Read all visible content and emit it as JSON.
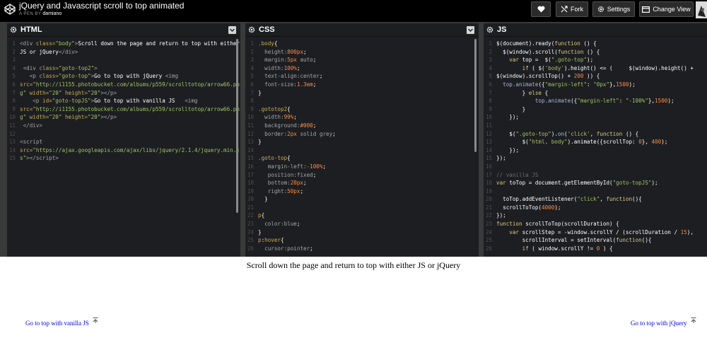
{
  "header": {
    "title": "jQuery and Javascript scroll to top animated",
    "byline_prefix": "A PEN BY ",
    "author": "damiano",
    "buttons": {
      "heart_label": "",
      "fork_label": "Fork",
      "settings_label": "Settings",
      "change_view_label": "Change View"
    }
  },
  "panels": {
    "html": {
      "name": "HTML",
      "lines": [
        [
          [
            "c-tag",
            "<div "
          ],
          [
            "c-at",
            "class="
          ],
          [
            "c-st",
            "\"body\""
          ],
          [
            "c-tag",
            ">"
          ],
          [
            "c-tx",
            "Scroll down the page and return to top with either"
          ]
        ],
        [
          [
            "c-tx",
            "JS or jQuery"
          ],
          [
            "c-tag",
            "</div>"
          ]
        ],
        [],
        [
          [
            "c-tag",
            " <div "
          ],
          [
            "c-at",
            "class="
          ],
          [
            "c-st",
            "\"goto-top2\""
          ],
          [
            "c-tag",
            ">"
          ]
        ],
        [
          [
            "c-tag",
            "   <p "
          ],
          [
            "c-at",
            "class="
          ],
          [
            "c-st",
            "\"goto-top\""
          ],
          [
            "c-tag",
            ">"
          ],
          [
            "c-tx",
            "Go to top with jQuery "
          ],
          [
            "c-tag",
            "<img"
          ]
        ],
        [
          [
            "c-at",
            "src="
          ],
          [
            "c-st",
            "\"http://i1155.photobucket.com/albums/p559/scrolltotop/arrow66.pn"
          ]
        ],
        [
          [
            "c-st",
            "g\" "
          ],
          [
            "c-at",
            "width="
          ],
          [
            "c-st",
            "\"20\" "
          ],
          [
            "c-at",
            "height="
          ],
          [
            "c-st",
            "\"20\""
          ],
          [
            "c-tag",
            "></p>"
          ]
        ],
        [
          [
            "c-tag",
            "    <p "
          ],
          [
            "c-at",
            "id="
          ],
          [
            "c-st",
            "\"goto-topJS\""
          ],
          [
            "c-tag",
            ">"
          ],
          [
            "c-tx",
            "Go to top with vanilla JS   "
          ],
          [
            "c-tag",
            "<img"
          ]
        ],
        [
          [
            "c-at",
            "src="
          ],
          [
            "c-st",
            "\"http://i1155.photobucket.com/albums/p559/scrolltotop/arrow66.pn"
          ]
        ],
        [
          [
            "c-st",
            "g\" "
          ],
          [
            "c-at",
            "width="
          ],
          [
            "c-st",
            "\"20\" "
          ],
          [
            "c-at",
            "height="
          ],
          [
            "c-st",
            "\"20\""
          ],
          [
            "c-tag",
            "></p>"
          ]
        ],
        [
          [
            "c-tag",
            " </div>"
          ]
        ],
        [],
        [
          [
            "c-tag",
            "<script"
          ]
        ],
        [
          [
            "c-at",
            "src="
          ],
          [
            "c-st",
            "\"https://ajax.googleapis.com/ajax/libs/jquery/2.1.4/jquery.min.j"
          ]
        ],
        [
          [
            "c-st",
            "s\""
          ],
          [
            "c-tag",
            "></"
          ],
          [
            "c-tag",
            "script>"
          ]
        ]
      ]
    },
    "css": {
      "name": "CSS",
      "lines": [
        [
          [
            "c-sel",
            ".body"
          ],
          [
            "c-pn",
            "{"
          ]
        ],
        [
          [
            "c-pr",
            "  height:"
          ],
          [
            "c-val",
            "800px"
          ],
          [
            "c-pn",
            ";"
          ]
        ],
        [
          [
            "c-pr",
            "  margin:"
          ],
          [
            "c-val",
            "5px "
          ],
          [
            "c-pr",
            "auto"
          ],
          [
            "c-pn",
            ";"
          ]
        ],
        [
          [
            "c-pr",
            "  width:"
          ],
          [
            "c-val",
            "100%"
          ],
          [
            "c-pn",
            ";"
          ]
        ],
        [
          [
            "c-pr",
            "  text-align:"
          ],
          [
            "c-pr",
            "center"
          ],
          [
            "c-pn",
            ";"
          ]
        ],
        [
          [
            "c-pr",
            "  font-size:"
          ],
          [
            "c-val",
            "1.3em"
          ],
          [
            "c-pn",
            ";"
          ]
        ],
        [
          [
            "c-pn",
            "}"
          ]
        ],
        [],
        [
          [
            "c-sel",
            ".gototop2"
          ],
          [
            "c-pn",
            "{"
          ]
        ],
        [
          [
            "c-pr",
            "  width:"
          ],
          [
            "c-val",
            "99%"
          ],
          [
            "c-pn",
            ";"
          ]
        ],
        [
          [
            "c-pr",
            "  background:"
          ],
          [
            "c-val",
            "#000"
          ],
          [
            "c-pn",
            ";"
          ]
        ],
        [
          [
            "c-pr",
            "  border:"
          ],
          [
            "c-val",
            "2px "
          ],
          [
            "c-pr",
            "solid grey"
          ],
          [
            "c-pn",
            ";"
          ]
        ],
        [
          [
            "c-pn",
            "}"
          ]
        ],
        [],
        [
          [
            "c-sel",
            ".goto-top"
          ],
          [
            "c-pn",
            "{"
          ]
        ],
        [
          [
            "c-pr",
            "   margin-left:"
          ],
          [
            "c-val",
            "-100%"
          ],
          [
            "c-pn",
            ";"
          ]
        ],
        [
          [
            "c-pr",
            "   position:"
          ],
          [
            "c-pr",
            "fixed"
          ],
          [
            "c-pn",
            ";"
          ]
        ],
        [
          [
            "c-pr",
            "   bottom:"
          ],
          [
            "c-val",
            "20px"
          ],
          [
            "c-pn",
            ";"
          ]
        ],
        [
          [
            "c-pr",
            "   right:"
          ],
          [
            "c-val",
            "50px"
          ],
          [
            "c-pn",
            ";"
          ]
        ],
        [
          [
            "c-pn",
            "  }"
          ]
        ],
        [],
        [
          [
            "c-sel",
            "p"
          ],
          [
            "c-pn",
            "{"
          ]
        ],
        [
          [
            "c-pr",
            "  color:"
          ],
          [
            "c-pr",
            "blue"
          ],
          [
            "c-pn",
            ";"
          ]
        ],
        [
          [
            "c-pn",
            "}"
          ]
        ],
        [
          [
            "c-sel",
            "p"
          ],
          [
            "c-pn",
            ":"
          ],
          [
            "c-sel",
            "hover"
          ],
          [
            "c-pn",
            "{"
          ]
        ],
        [
          [
            "c-pr",
            "  cursor:"
          ],
          [
            "c-pr",
            "pointer"
          ],
          [
            "c-pn",
            ";"
          ]
        ]
      ]
    },
    "js": {
      "name": "JS",
      "lines": [
        [
          [
            "c-fn",
            "$(document).ready("
          ],
          [
            "c-kw",
            "function"
          ],
          [
            "c-fn",
            " () {"
          ]
        ],
        [
          [
            "c-fn",
            "  $(window).scroll("
          ],
          [
            "c-kw",
            "function"
          ],
          [
            "c-fn",
            " () {"
          ]
        ],
        [
          [
            "c-kw",
            "    var "
          ],
          [
            "c-id",
            "top = "
          ],
          [
            "c-fn",
            " $("
          ],
          [
            "c-jsstr",
            "\".goto-top\""
          ],
          [
            "c-fn",
            ");"
          ]
        ],
        [
          [
            "c-kw",
            "        if "
          ],
          [
            "c-fn",
            "( $("
          ],
          [
            "c-jsstr",
            "'body'"
          ],
          [
            "c-fn",
            ").height() <= (     $(window).height() +"
          ]
        ],
        [
          [
            "c-fn",
            "$(window).scrollTop() + "
          ],
          [
            "c-num",
            "200"
          ],
          [
            "c-fn",
            " )) {"
          ]
        ],
        [
          [
            "c-prop",
            "  top.animate"
          ],
          [
            "c-fn",
            "({"
          ],
          [
            "c-jsstr",
            "\"margin-left\""
          ],
          [
            "c-fn",
            ": "
          ],
          [
            "c-jsstr",
            "\"0px\""
          ],
          [
            "c-fn",
            "},"
          ],
          [
            "c-num",
            "1500"
          ],
          [
            "c-fn",
            ");"
          ]
        ],
        [
          [
            "c-fn",
            "        } "
          ],
          [
            "c-kw",
            "else"
          ],
          [
            "c-fn",
            " {"
          ]
        ],
        [
          [
            "c-prop",
            "            top.animate"
          ],
          [
            "c-fn",
            "({"
          ],
          [
            "c-jsstr",
            "\"margin-left\""
          ],
          [
            "c-fn",
            ": "
          ],
          [
            "c-jsstr",
            "\"-100%\""
          ],
          [
            "c-fn",
            "},"
          ],
          [
            "c-num",
            "1500"
          ],
          [
            "c-fn",
            ");"
          ]
        ],
        [
          [
            "c-fn",
            "        }"
          ]
        ],
        [
          [
            "c-fn",
            "    });"
          ]
        ],
        [],
        [
          [
            "c-fn",
            "    $("
          ],
          [
            "c-jsstr",
            "\".goto-top\""
          ],
          [
            "c-fn",
            ")."
          ],
          [
            "c-prop",
            "on"
          ],
          [
            "c-fn",
            "("
          ],
          [
            "c-jsstr",
            "'click'"
          ],
          [
            "c-fn",
            ", "
          ],
          [
            "c-kw",
            "function"
          ],
          [
            "c-fn",
            " () {"
          ]
        ],
        [
          [
            "c-fn",
            "        $("
          ],
          [
            "c-jsstr",
            "\"html, body\""
          ],
          [
            "c-fn",
            ").animate({scrollTop: "
          ],
          [
            "c-num",
            "0"
          ],
          [
            "c-fn",
            "}, "
          ],
          [
            "c-num",
            "400"
          ],
          [
            "c-fn",
            ");"
          ]
        ],
        [
          [
            "c-fn",
            "    });"
          ]
        ],
        [
          [
            "c-fn",
            "});"
          ]
        ],
        [],
        [
          [
            "c-cm",
            "// vanilla JS"
          ]
        ],
        [
          [
            "c-kw",
            "var "
          ],
          [
            "c-id",
            "toTop = document.getElementById("
          ],
          [
            "c-jsstr",
            "\"goto-topJS\""
          ],
          [
            "c-fn",
            ");"
          ]
        ],
        [],
        [
          [
            "c-id",
            "  toTop.addEventListener("
          ],
          [
            "c-jsstr",
            "\"click\""
          ],
          [
            "c-fn",
            ", "
          ],
          [
            "c-kw",
            "function"
          ],
          [
            "c-fn",
            "(){"
          ]
        ],
        [
          [
            "c-id",
            "  scrollToTop("
          ],
          [
            "c-num",
            "4000"
          ],
          [
            "c-fn",
            ");"
          ]
        ],
        [
          [
            "c-fn",
            "});"
          ]
        ],
        [
          [
            "c-kw",
            "function "
          ],
          [
            "c-id",
            "scrollToTop(scrollDuration) {"
          ]
        ],
        [
          [
            "c-kw",
            "    var "
          ],
          [
            "c-id",
            "scrollStep = -window.scrollY / (scrollDuration / "
          ],
          [
            "c-num",
            "15"
          ],
          [
            "c-fn",
            "),"
          ]
        ],
        [
          [
            "c-id",
            "        scrollInterval = setInterval("
          ],
          [
            "c-kw",
            "function"
          ],
          [
            "c-fn",
            "(){"
          ]
        ],
        [
          [
            "c-kw",
            "        if "
          ],
          [
            "c-fn",
            "( window.scrollY != "
          ],
          [
            "c-num",
            "0"
          ],
          [
            "c-fn",
            " ) {"
          ]
        ]
      ]
    }
  },
  "preview": {
    "body_text": "Scroll down the page and return to top with either JS or jQuery",
    "link_vanilla": "Go to top with vanilla JS",
    "link_jquery": "Go to top with jQuery"
  },
  "icons": [
    "codepen-logo-icon",
    "heart-icon",
    "fork-icon",
    "gear-icon",
    "change-view-icon",
    "avatar",
    "chevron-down-icon",
    "scroll-top-arrow-icon"
  ]
}
